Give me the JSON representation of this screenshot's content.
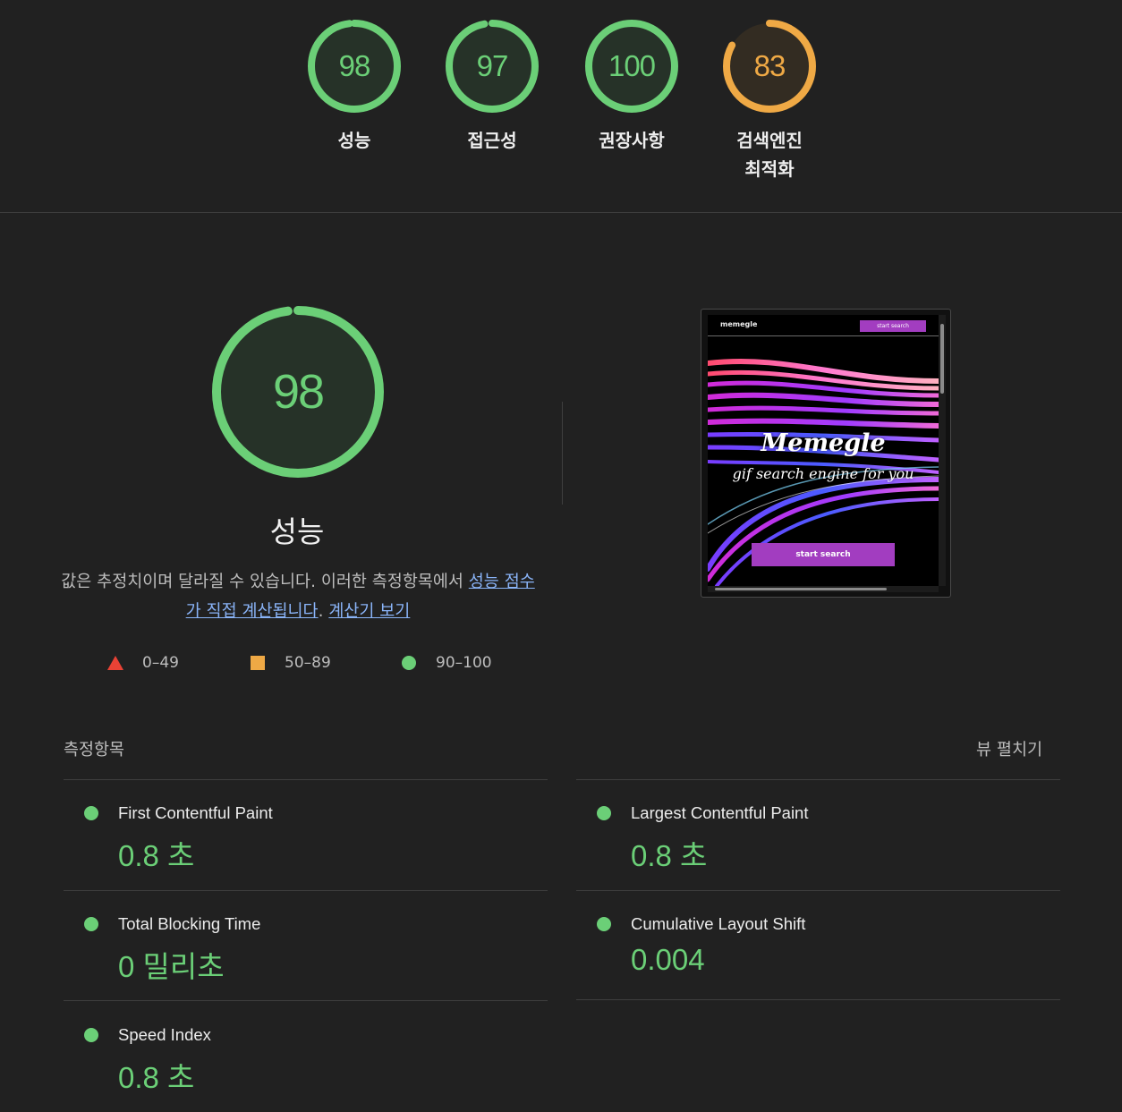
{
  "colors": {
    "pass": "#6bcf77",
    "average": "#efa945",
    "fail": "#e94235",
    "link": "#8ab4f8",
    "pass_track": "#263228",
    "average_track": "#332c22"
  },
  "categories": [
    {
      "label": "성능",
      "score": 98,
      "rating": "pass",
      "fraction": 0.98
    },
    {
      "label": "접근성",
      "score": 97,
      "rating": "pass",
      "fraction": 0.97
    },
    {
      "label": "권장사항",
      "score": 100,
      "rating": "pass",
      "fraction": 1.0
    },
    {
      "label": "검색엔진\n최적화",
      "score": 83,
      "rating": "average",
      "fraction": 0.83
    }
  ],
  "performance": {
    "score": 98,
    "fraction": 0.98,
    "title": "성능",
    "desc_prefix": "값은 추정치이며 달라질 수 있습니다. 이러한 측정항목에서 ",
    "desc_link1": "성능 점수가 직접 계산됩니다",
    "desc_mid": ". ",
    "desc_link2": "계산기 보기"
  },
  "legend": [
    {
      "shape": "triangle-icon",
      "range": "0–49"
    },
    {
      "shape": "square-icon",
      "range": "50–89"
    },
    {
      "shape": "circle-icon",
      "range": "90–100"
    }
  ],
  "screenshot": {
    "brand": "memegle",
    "nav_button": "start search",
    "hero_title": "Memegle",
    "hero_subtitle": "gif search engine for you",
    "cta_button": "start search"
  },
  "metrics_section": {
    "title": "측정항목",
    "expand_label": "뷰 펼치기"
  },
  "metrics": [
    {
      "name": "First Contentful Paint",
      "value": "0.8 초"
    },
    {
      "name": "Largest Contentful Paint",
      "value": "0.8 초"
    },
    {
      "name": "Total Blocking Time",
      "value": "0 밀리초"
    },
    {
      "name": "Cumulative Layout Shift",
      "value": "0.004"
    },
    {
      "name": "Speed Index",
      "value": "0.8 초"
    }
  ]
}
